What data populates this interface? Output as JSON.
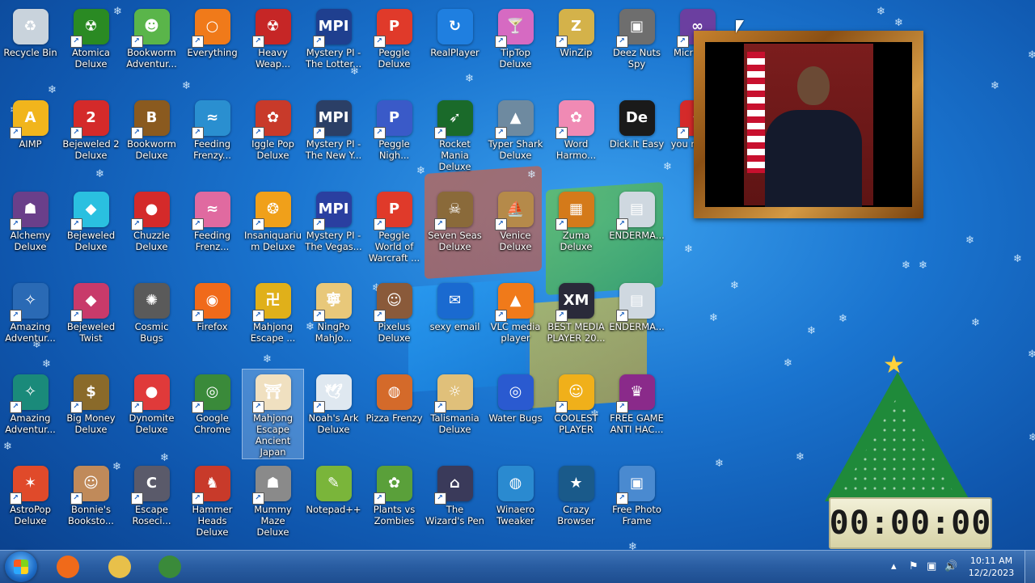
{
  "desktop": {
    "icons": [
      {
        "label": "Recycle Bin",
        "color": "#c9d3dc",
        "glyph": "♻",
        "shortcut": false,
        "selected": false
      },
      {
        "label": "Atomica Deluxe",
        "color": "#2a8a23",
        "glyph": "☢",
        "shortcut": true,
        "selected": false
      },
      {
        "label": "Bookworm Adventur...",
        "color": "#5ab54a",
        "glyph": "☻",
        "shortcut": true,
        "selected": false
      },
      {
        "label": "Everything",
        "color": "#f07a1a",
        "glyph": "○",
        "shortcut": true,
        "selected": false
      },
      {
        "label": "Heavy Weap...",
        "color": "#c62626",
        "glyph": "☢",
        "shortcut": true,
        "selected": false
      },
      {
        "label": "Mystery PI - The Lotter...",
        "color": "#1f3f8f",
        "glyph": "MPI",
        "shortcut": true,
        "selected": false
      },
      {
        "label": "Peggle Deluxe",
        "color": "#e03a2a",
        "glyph": "P",
        "shortcut": true,
        "selected": false
      },
      {
        "label": "RealPlayer",
        "color": "#1f7fe0",
        "glyph": "↻",
        "shortcut": false,
        "selected": false
      },
      {
        "label": "TipTop Deluxe",
        "color": "#d66ac2",
        "glyph": "🍸",
        "shortcut": true,
        "selected": false
      },
      {
        "label": "WinZip",
        "color": "#d4b24a",
        "glyph": "Z",
        "shortcut": true,
        "selected": false
      },
      {
        "label": "Deez Nuts Spy",
        "color": "#6e6e6e",
        "glyph": "▣",
        "shortcut": true,
        "selected": false
      },
      {
        "label": "Micr Visua",
        "color": "#6b3fa0",
        "glyph": "∞",
        "shortcut": true,
        "selected": false
      },
      {
        "label": "AIMP",
        "color": "#f1b51c",
        "glyph": "A",
        "shortcut": true,
        "selected": false
      },
      {
        "label": "Bejeweled 2 Deluxe",
        "color": "#d42a2a",
        "glyph": "2",
        "shortcut": true,
        "selected": false
      },
      {
        "label": "Bookworm Deluxe",
        "color": "#8a5a1f",
        "glyph": "B",
        "shortcut": true,
        "selected": false
      },
      {
        "label": "Feeding Frenzy...",
        "color": "#2a8fd0",
        "glyph": "≈",
        "shortcut": true,
        "selected": false
      },
      {
        "label": "Iggle Pop Deluxe",
        "color": "#c83a2a",
        "glyph": "✿",
        "shortcut": true,
        "selected": false
      },
      {
        "label": "Mystery PI - The New Y...",
        "color": "#2b3f66",
        "glyph": "MPI",
        "shortcut": true,
        "selected": false
      },
      {
        "label": "Peggle Nigh...",
        "color": "#3a5ac8",
        "glyph": "P",
        "shortcut": true,
        "selected": false
      },
      {
        "label": "Rocket Mania Deluxe",
        "color": "#1a6a2a",
        "glyph": "➶",
        "shortcut": true,
        "selected": false
      },
      {
        "label": "Typer Shark Deluxe",
        "color": "#6e8aa0",
        "glyph": "▲",
        "shortcut": true,
        "selected": false
      },
      {
        "label": "Word Harmo...",
        "color": "#f08ab4",
        "glyph": "✿",
        "shortcut": true,
        "selected": false
      },
      {
        "label": "Dick.It Easy",
        "color": "#1a1a1a",
        "glyph": "De",
        "shortcut": false,
        "selected": false
      },
      {
        "label": "you m dont",
        "color": "#d42a2a",
        "glyph": "♦",
        "shortcut": true,
        "selected": false
      },
      {
        "label": "Alchemy Deluxe",
        "color": "#6a3f8a",
        "glyph": "☗",
        "shortcut": true,
        "selected": false
      },
      {
        "label": "Bejeweled Deluxe",
        "color": "#2ac0e0",
        "glyph": "◆",
        "shortcut": true,
        "selected": false
      },
      {
        "label": "Chuzzle Deluxe",
        "color": "#d42a2a",
        "glyph": "●",
        "shortcut": true,
        "selected": false
      },
      {
        "label": "Feeding Frenz...",
        "color": "#e06aa0",
        "glyph": "≈",
        "shortcut": true,
        "selected": false
      },
      {
        "label": "Insaniquarium Deluxe",
        "color": "#f0a01a",
        "glyph": "❂",
        "shortcut": true,
        "selected": false
      },
      {
        "label": "Mystery PI - The Vegas...",
        "color": "#2a3fa0",
        "glyph": "MPI",
        "shortcut": true,
        "selected": false
      },
      {
        "label": "Peggle World of Warcraft ...",
        "color": "#e03a2a",
        "glyph": "P",
        "shortcut": true,
        "selected": false
      },
      {
        "label": "Seven Seas Deluxe",
        "color": "#8a6a3a",
        "glyph": "☠",
        "shortcut": true,
        "selected": false
      },
      {
        "label": "Venice Deluxe",
        "color": "#b58a4a",
        "glyph": "⛵",
        "shortcut": true,
        "selected": false
      },
      {
        "label": "Zuma Deluxe",
        "color": "#d47a1a",
        "glyph": "▦",
        "shortcut": true,
        "selected": false
      },
      {
        "label": "ENDERMA...",
        "color": "#cfd8e0",
        "glyph": "▤",
        "shortcut": true,
        "selected": false
      },
      {
        "label": "Amazing Adventur...",
        "color": "#2a6ab5",
        "glyph": "✧",
        "shortcut": true,
        "selected": false
      },
      {
        "label": "Bejeweled Twist",
        "color": "#c83a6a",
        "glyph": "◆",
        "shortcut": true,
        "selected": false
      },
      {
        "label": "Cosmic Bugs",
        "color": "#5a5a5a",
        "glyph": "✺",
        "shortcut": false,
        "selected": false
      },
      {
        "label": "Firefox",
        "color": "#f06a1a",
        "glyph": "◉",
        "shortcut": true,
        "selected": false
      },
      {
        "label": "Mahjong Escape ...",
        "color": "#e0b01a",
        "glyph": "卍",
        "shortcut": true,
        "selected": false
      },
      {
        "label": "NingPo MahJo...",
        "color": "#e8c87a",
        "glyph": "寧",
        "shortcut": true,
        "selected": false
      },
      {
        "label": "Pixelus Deluxe",
        "color": "#8a5a3a",
        "glyph": "☺",
        "shortcut": true,
        "selected": false
      },
      {
        "label": "sexy email",
        "color": "#1a6ad0",
        "glyph": "✉",
        "shortcut": false,
        "selected": false
      },
      {
        "label": "VLC media player",
        "color": "#f07a1a",
        "glyph": "▲",
        "shortcut": true,
        "selected": false
      },
      {
        "label": "BEST MEDIA PLAYER 20...",
        "color": "#2a2a3a",
        "glyph": "XM",
        "shortcut": true,
        "selected": false
      },
      {
        "label": "ENDERMA...",
        "color": "#cfd8e0",
        "glyph": "▤",
        "shortcut": true,
        "selected": false
      },
      {
        "label": "Amazing Adventur...",
        "color": "#1a8a7a",
        "glyph": "✧",
        "shortcut": true,
        "selected": false
      },
      {
        "label": "Big Money Deluxe",
        "color": "#8a6a2a",
        "glyph": "$",
        "shortcut": true,
        "selected": false
      },
      {
        "label": "Dynomite Deluxe",
        "color": "#e03a3a",
        "glyph": "●",
        "shortcut": true,
        "selected": false
      },
      {
        "label": "Google Chrome",
        "color": "#3a8a3a",
        "glyph": "◎",
        "shortcut": true,
        "selected": false
      },
      {
        "label": "Mahjong Escape Ancient Japan",
        "color": "#f0e0c0",
        "glyph": "⛩",
        "shortcut": true,
        "selected": true
      },
      {
        "label": "Noah's Ark Deluxe",
        "color": "#dfe8f0",
        "glyph": "🕊",
        "shortcut": true,
        "selected": false
      },
      {
        "label": "Pizza Frenzy",
        "color": "#d46a2a",
        "glyph": "◍",
        "shortcut": false,
        "selected": false
      },
      {
        "label": "Talismania Deluxe",
        "color": "#e0c07a",
        "glyph": "☼",
        "shortcut": true,
        "selected": false
      },
      {
        "label": "Water Bugs",
        "color": "#2a5ad0",
        "glyph": "◎",
        "shortcut": false,
        "selected": false
      },
      {
        "label": "COOLEST PLAYER",
        "color": "#f0b01a",
        "glyph": "☺",
        "shortcut": true,
        "selected": false
      },
      {
        "label": "FREE GAME ANTI HAC...",
        "color": "#8a2a8a",
        "glyph": "♛",
        "shortcut": true,
        "selected": false
      },
      {
        "label": "AstroPop Deluxe",
        "color": "#e04a2a",
        "glyph": "✶",
        "shortcut": true,
        "selected": false
      },
      {
        "label": "Bonnie's Booksto...",
        "color": "#c08a5a",
        "glyph": "☺",
        "shortcut": true,
        "selected": false
      },
      {
        "label": "Escape Roseci...",
        "color": "#5a5a6a",
        "glyph": "C",
        "shortcut": true,
        "selected": false
      },
      {
        "label": "Hammer Heads Deluxe",
        "color": "#c83a2a",
        "glyph": "♞",
        "shortcut": true,
        "selected": false
      },
      {
        "label": "Mummy Maze Deluxe",
        "color": "#8a8a8a",
        "glyph": "☗",
        "shortcut": true,
        "selected": false
      },
      {
        "label": "Notepad++",
        "color": "#7ab53a",
        "glyph": "✎",
        "shortcut": false,
        "selected": false
      },
      {
        "label": "Plants vs Zombies",
        "color": "#5aa03a",
        "glyph": "✿",
        "shortcut": true,
        "selected": false
      },
      {
        "label": "The Wizard's Pen",
        "color": "#3a3a5a",
        "glyph": "⌂",
        "shortcut": true,
        "selected": false
      },
      {
        "label": "Winaero Tweaker",
        "color": "#2a8ad0",
        "glyph": "◍",
        "shortcut": false,
        "selected": false
      },
      {
        "label": "Crazy Browser",
        "color": "#1a5a8a",
        "glyph": "★",
        "shortcut": false,
        "selected": false
      },
      {
        "label": "Free Photo Frame",
        "color": "#4a8ad0",
        "glyph": "▣",
        "shortcut": true,
        "selected": false
      }
    ]
  },
  "widgets": {
    "countdown_clock": "00:00:00"
  },
  "taskbar": {
    "apps": [
      {
        "name": "firefox",
        "color": "#f06a1a"
      },
      {
        "name": "file-explorer",
        "color": "#e8c04a"
      },
      {
        "name": "chrome",
        "color": "#3a8a3a"
      }
    ],
    "tray": {
      "time": "10:11 AM",
      "date": "12/2/2023"
    }
  }
}
